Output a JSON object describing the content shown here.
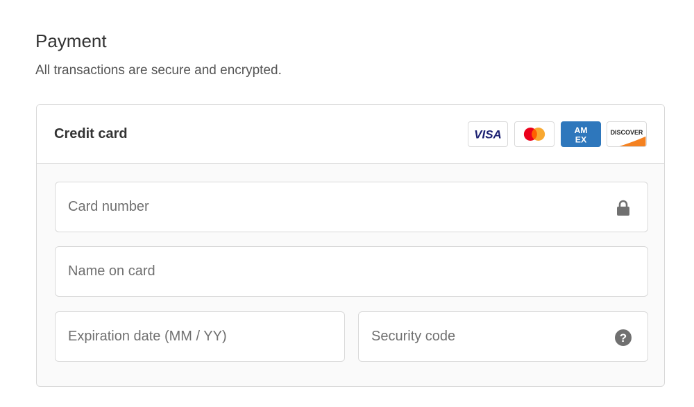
{
  "payment": {
    "title": "Payment",
    "subtitle": "All transactions are secure and encrypted."
  },
  "credit_card": {
    "label": "Credit card",
    "brands": [
      {
        "name": "visa",
        "text": "VISA"
      },
      {
        "name": "mastercard",
        "text": ""
      },
      {
        "name": "amex",
        "text": "AMEX"
      },
      {
        "name": "discover",
        "text": "DISCOVER"
      }
    ]
  },
  "fields": {
    "card_number": {
      "placeholder": "Card number",
      "value": "",
      "icon": "lock-icon"
    },
    "name_on_card": {
      "placeholder": "Name on card",
      "value": ""
    },
    "expiration": {
      "placeholder": "Expiration date (MM / YY)",
      "value": ""
    },
    "security_code": {
      "placeholder": "Security code",
      "value": "",
      "icon": "help-icon"
    }
  },
  "colors": {
    "visa_blue": "#1a1f71",
    "mastercard_red": "#eb001b",
    "mastercard_yellow": "#f79e1b",
    "amex_blue": "#2e77bc",
    "discover_orange": "#f48120",
    "icon_gray": "#707070"
  }
}
